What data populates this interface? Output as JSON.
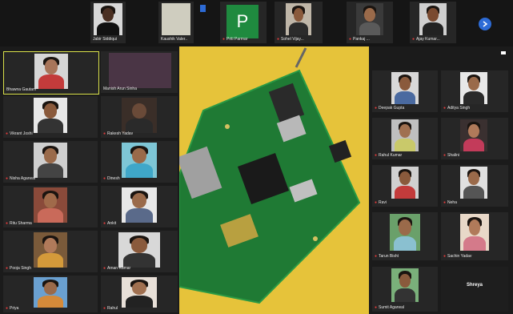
{
  "top_strip": [
    {
      "name": "Jabir Siddiqui",
      "muted": false
    },
    {
      "name": "Kaushik Valer..",
      "muted": false
    },
    {
      "name": "Priti Parmar",
      "muted": true
    },
    {
      "name": "Sohel Vijay...",
      "muted": true
    },
    {
      "name": "Pankaj ...",
      "muted": true
    },
    {
      "name": "Ajay Kumar...",
      "muted": true
    }
  ],
  "top_initial": "P",
  "left_grid": [
    {
      "name": "Bhawna Gautam",
      "muted": false
    },
    {
      "name": "Manish Arun Sinha",
      "muted": false
    },
    {
      "name": "Vikrant Joshi",
      "muted": true
    },
    {
      "name": "Rakesh Yadav",
      "muted": true
    },
    {
      "name": "Nisha Agarwal",
      "muted": true
    },
    {
      "name": "Dinesh",
      "muted": true
    },
    {
      "name": "Ritu Sharma",
      "muted": true
    },
    {
      "name": "Ankit",
      "muted": true
    },
    {
      "name": "Pooja Singh",
      "muted": true
    },
    {
      "name": "Aman Kumar",
      "muted": true
    },
    {
      "name": "Priya",
      "muted": true
    },
    {
      "name": "Rahul",
      "muted": true
    }
  ],
  "right_grid": [
    {
      "name": "Deepak Gupta",
      "muted": true
    },
    {
      "name": "Aditya Singh",
      "muted": true
    },
    {
      "name": "Rahul Kumar",
      "muted": true
    },
    {
      "name": "Shalini",
      "muted": true
    },
    {
      "name": "Ravi",
      "muted": true
    },
    {
      "name": "Neha",
      "muted": true
    },
    {
      "name": "Tarun Bisht",
      "muted": true
    },
    {
      "name": "Sachin Yadav",
      "muted": true
    },
    {
      "name": "Sumit Agarwal",
      "muted": true
    },
    {
      "name": "Shreya",
      "muted": false
    }
  ],
  "colors": {
    "stage_bg": "#e6c33a",
    "pcb": "#1f7a34",
    "initial_tile": "#1f8a3f",
    "muted_icon": "#e23b3b",
    "button": "#2d6bd6"
  }
}
